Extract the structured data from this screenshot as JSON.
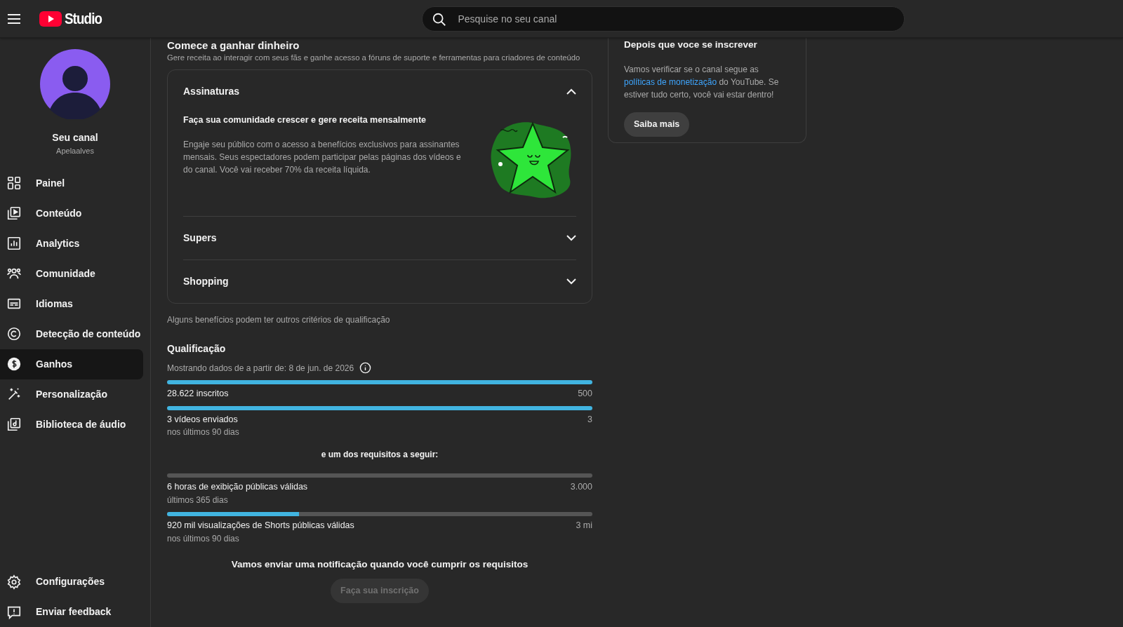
{
  "header": {
    "logo": "Studio",
    "search_placeholder": "Pesquise no seu canal"
  },
  "channel": {
    "name": "Seu canal",
    "handle": "Apelaalves"
  },
  "nav": [
    {
      "label": "Painel",
      "selected": false
    },
    {
      "label": "Conteúdo",
      "selected": false
    },
    {
      "label": "Analytics",
      "selected": false
    },
    {
      "label": "Comunidade",
      "selected": false
    },
    {
      "label": "Idiomas",
      "selected": false
    },
    {
      "label": "Detecção de conteúdo",
      "selected": false
    },
    {
      "label": "Ganhos",
      "selected": true
    },
    {
      "label": "Personalização",
      "selected": false
    },
    {
      "label": "Biblioteca de áudio",
      "selected": false
    }
  ],
  "nav_bottom": [
    {
      "label": "Configurações",
      "selected": false
    },
    {
      "label": "Enviar feedback",
      "selected": false
    }
  ],
  "section": {
    "title": "Comece a ganhar dinheiro",
    "subtitle": "Gere receita ao interagir com seus fãs e ganhe acesso a fóruns de suporte e ferramentas para criadores de conteúdo"
  },
  "accordion": [
    {
      "title": "Assinaturas",
      "expanded": true,
      "heading": "Faça sua comunidade crescer e gere receita mensalmente",
      "body": "Engaje seu público com o acesso a benefícios exclusivos para assinantes mensais. Seus espectadores podem participar pelas páginas dos vídeos e do canal. Você vai receber 70% da receita líquida."
    },
    {
      "title": "Supers",
      "expanded": false
    },
    {
      "title": "Shopping",
      "expanded": false
    }
  ],
  "note": "Alguns benefícios podem ter outros critérios de qualificação",
  "qualification": {
    "title": "Qualificação",
    "date_text": "Mostrando dados de a partir de: 8 de jun. de 2026",
    "required": [
      {
        "label": "28.622 inscritos",
        "target": "500",
        "level": 1
      },
      {
        "label": "3 vídeos enviados",
        "sublabel": "nos últimos 90 dias",
        "target": "3",
        "level": 1
      }
    ],
    "one_of_label": "e um dos requisitos a seguir:",
    "one_of": [
      {
        "label": "6 horas de exibição públicas válidas",
        "sublabel": "últimos 365 dias",
        "target": "3.000",
        "level": 0
      },
      {
        "label": "920 mil visualizações de Shorts públicas válidas",
        "sublabel": "nos últimos 90 dias",
        "target": "3 mi",
        "level": 0.31
      }
    ],
    "notice": "Vamos enviar uma notificação quando você cumprir os requisitos",
    "button": {
      "label": "Faça sua inscrição",
      "disabled": true
    }
  },
  "side_card": {
    "title": "Depois que voce se inscrever",
    "text_before": "Vamos verificar se o canal segue as",
    "link": "políticas de monetização",
    "text_after": "do YouTube. Se estiver tudo certo, você vai estar dentro!",
    "button": "Saiba mais"
  }
}
